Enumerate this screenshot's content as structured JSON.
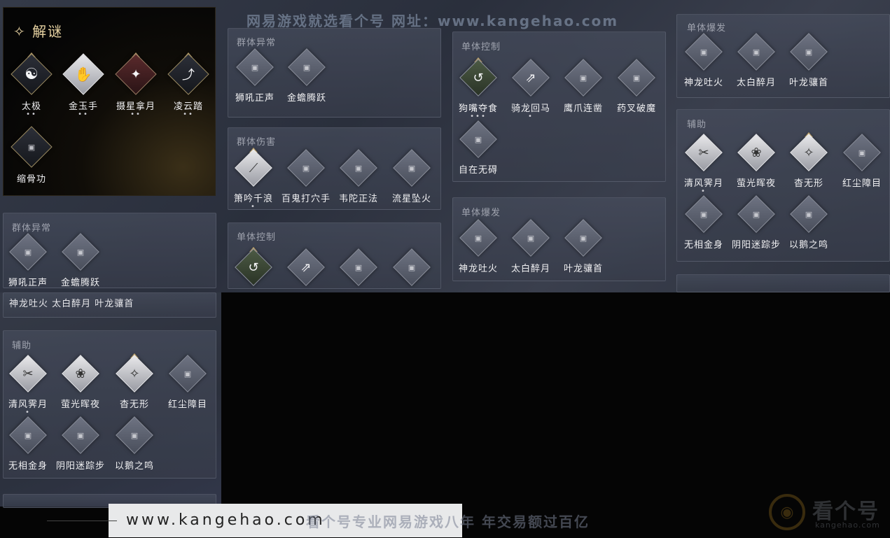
{
  "watermark_top": "网易游戏就选看个号  网址：www.kangehao.com",
  "watermark_bottom": "看个号专业网易游戏八年  年交易额过百亿",
  "bottom_url": "www.kangehao.com",
  "logo": {
    "name": "看个号",
    "sub": "kangehao.com"
  },
  "featured": {
    "title": "✧ 解谜",
    "skills": [
      {
        "name": "太极",
        "dots": "••",
        "style": "dark",
        "icon": "☯",
        "tip": true
      },
      {
        "name": "金玉手",
        "dots": "••",
        "style": "lit",
        "icon": "✋",
        "tip": false
      },
      {
        "name": "摄星拿月",
        "dots": "••",
        "style": "red",
        "icon": "✦",
        "tip": true
      },
      {
        "name": "凌云踏",
        "dots": "••",
        "style": "dark",
        "icon": "⤴",
        "tip": true
      },
      {
        "name": "缩骨功",
        "dots": "",
        "style": "dark",
        "icon": "▣",
        "tip": false
      }
    ]
  },
  "panels": {
    "p_group_abnormal_top": {
      "title": "群体异常",
      "skills": [
        {
          "name": "狮吼正声"
        },
        {
          "name": "金蟾腾跃"
        }
      ]
    },
    "p_group_damage": {
      "title": "群体伤害",
      "skills": [
        {
          "name": "箫吟千浪",
          "dots": "•",
          "icon": "⟋"
        },
        {
          "name": "百鬼打穴手"
        },
        {
          "name": "韦陀正法"
        },
        {
          "name": "流星坠火"
        }
      ]
    },
    "p_single_control_mid": {
      "title": "单体控制"
    },
    "p_single_control_top": {
      "title": "单体控制",
      "skills": [
        {
          "name": "狗嘴夺食",
          "dots": "•••",
          "icon": "↺"
        },
        {
          "name": "骑龙回马",
          "dots": "•",
          "icon": "⇗"
        },
        {
          "name": "鹰爪连凿"
        },
        {
          "name": "药叉破魔"
        },
        {
          "name": "自在无碍"
        }
      ]
    },
    "p_single_burst_mid": {
      "title": "单体爆发",
      "skills": [
        {
          "name": "神龙吐火"
        },
        {
          "name": "太白醉月"
        },
        {
          "name": "叶龙骧首"
        }
      ]
    },
    "p_single_burst_right": {
      "title": "单体爆发",
      "skills": [
        {
          "name": "神龙吐火"
        },
        {
          "name": "太白醉月"
        },
        {
          "name": "叶龙骧首"
        }
      ]
    },
    "p_support_right": {
      "title": "辅助",
      "skills": [
        {
          "name": "清风霁月",
          "dots": "•",
          "icon": "✂"
        },
        {
          "name": "萤光晖夜",
          "icon": "❀"
        },
        {
          "name": "杳无形",
          "icon": "✧"
        },
        {
          "name": "红尘障目"
        },
        {
          "name": "无相金身"
        },
        {
          "name": "阴阳迷踪步"
        },
        {
          "name": "以鹅之鸣"
        }
      ]
    },
    "p_group_abnormal_left": {
      "title": "群体异常",
      "skills": [
        {
          "name": "狮吼正声"
        },
        {
          "name": "金蟾腾跃"
        }
      ]
    },
    "p_burst_partial_left": {
      "row": "神龙吐火  太白醉月  叶龙骧首"
    },
    "p_support_left": {
      "title": "辅助",
      "skills": [
        {
          "name": "清风霁月",
          "dots": "•",
          "icon": "✂"
        },
        {
          "name": "萤光晖夜",
          "icon": "❀"
        },
        {
          "name": "杳无形",
          "icon": "✧"
        },
        {
          "name": "红尘障目"
        },
        {
          "name": "无相金身"
        },
        {
          "name": "阴阳迷踪步"
        },
        {
          "name": "以鹅之鸣"
        }
      ]
    }
  }
}
